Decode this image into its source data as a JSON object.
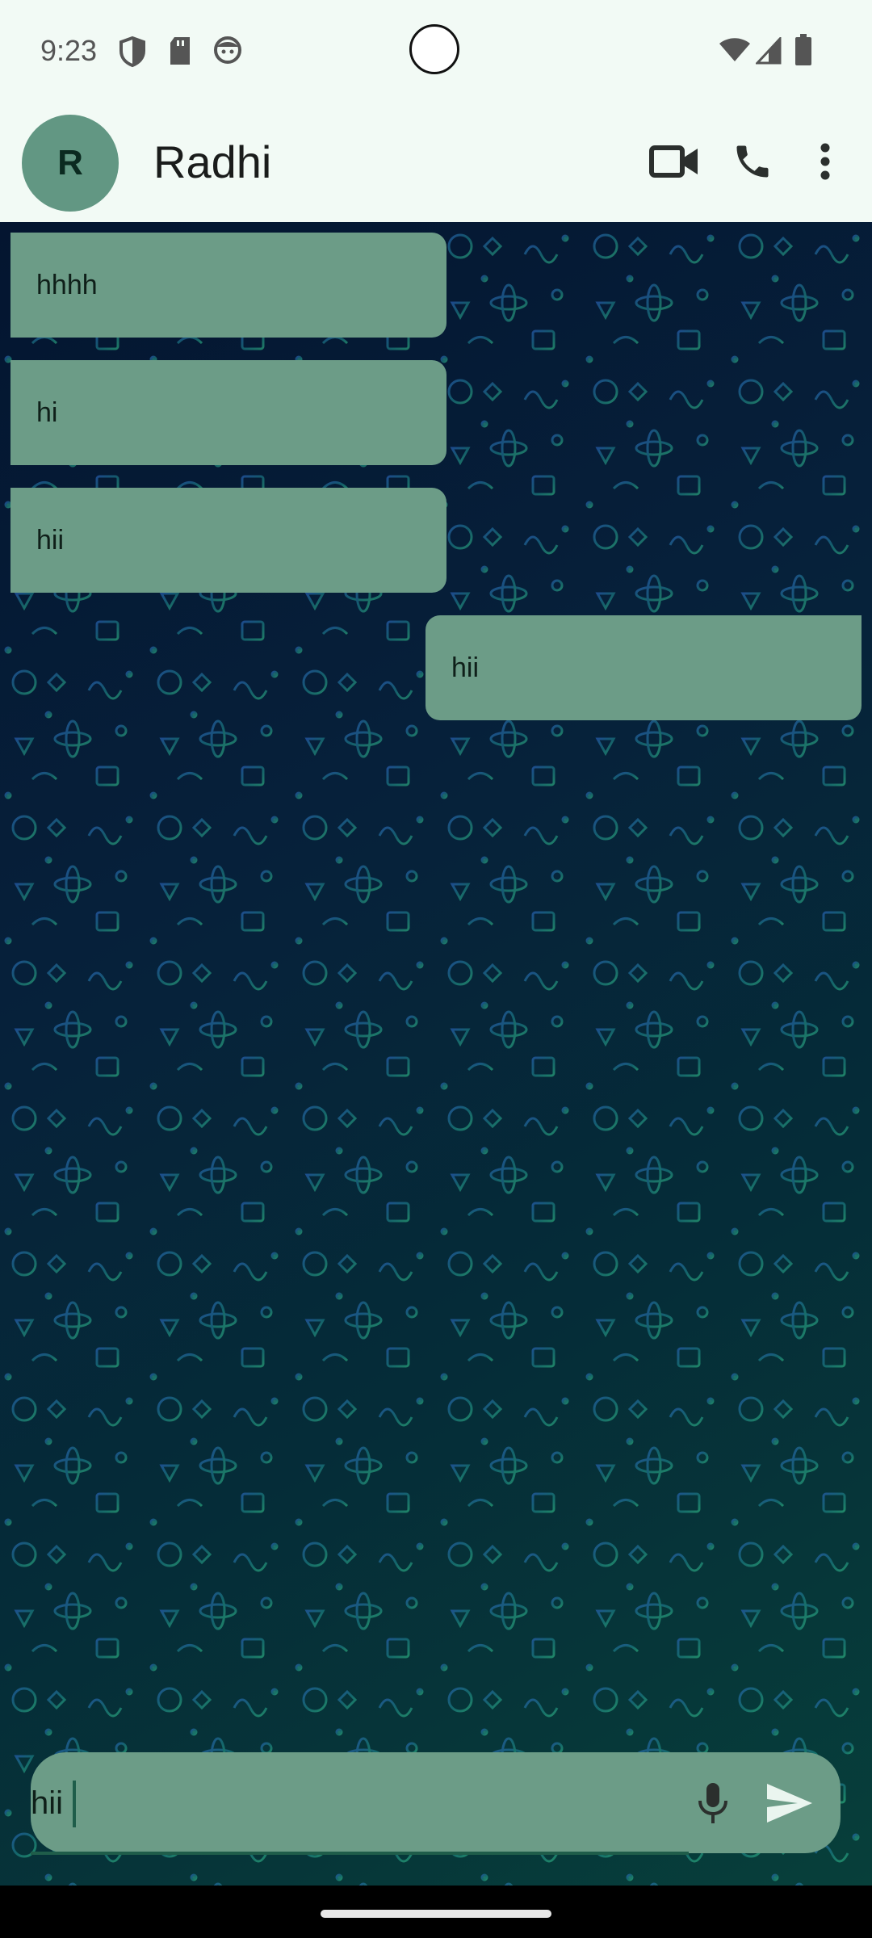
{
  "status_bar": {
    "time": "9:23",
    "icons_left": [
      "shield-icon",
      "sd-card-icon",
      "face-icon"
    ],
    "icons_right": [
      "wifi-icon",
      "cellular-signal-icon",
      "battery-icon"
    ]
  },
  "header": {
    "avatar_initial": "R",
    "contact_name": "Radhi",
    "actions": [
      "video-call-icon",
      "phone-call-icon",
      "more-vert-icon"
    ]
  },
  "messages": [
    {
      "direction": "received",
      "text": "hhhh"
    },
    {
      "direction": "received",
      "text": "hi"
    },
    {
      "direction": "received",
      "text": "hii"
    },
    {
      "direction": "sent",
      "text": "hii"
    }
  ],
  "composer": {
    "input_value": "hii",
    "mic_icon": "mic-icon",
    "send_icon": "send-icon"
  },
  "colors": {
    "bubble": "#6c9c87",
    "avatar": "#629783",
    "header_bg": "#f2faf5",
    "accent": "#1f5d4a"
  }
}
